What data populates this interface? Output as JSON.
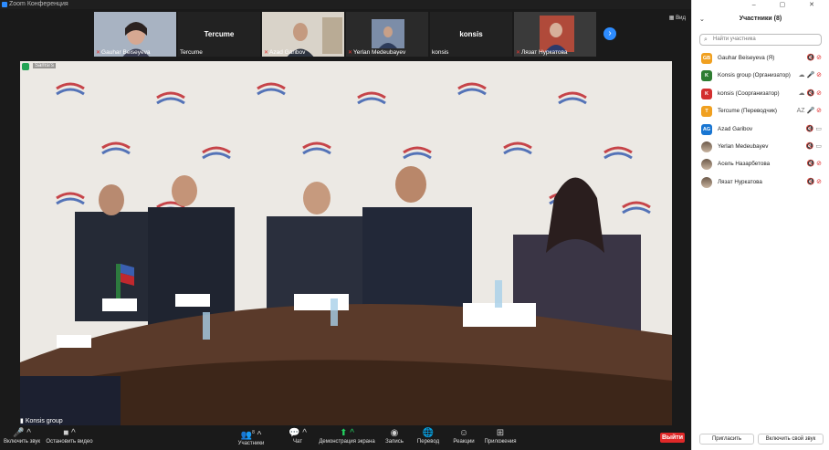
{
  "window": {
    "title": "Zoom Конференция"
  },
  "thumbnails": [
    {
      "name": "Gauhar Beiseyeva",
      "type": "video",
      "muted": true
    },
    {
      "name": "Tercume",
      "type": "name-only",
      "muted": false
    },
    {
      "name": "Azad Garibov",
      "type": "video",
      "muted": true
    },
    {
      "name": "Yerlan Medeubayev",
      "type": "video",
      "muted": true
    },
    {
      "name": "konsis",
      "type": "name-only",
      "muted": false
    },
    {
      "name": "Лязат Нуркатова",
      "type": "video",
      "muted": true
    }
  ],
  "view_button": "Вид",
  "main_video": {
    "speaker_badge": "Samsi's",
    "active_speaker": "Konsis group"
  },
  "toolbar": {
    "unmute": "Включить звук",
    "start_video": "Остановить видео",
    "participants": "Участники",
    "participants_count": "8",
    "chat": "Чат",
    "share": "Демонстрация экрана",
    "record": "Запись",
    "translate": "Перевод",
    "reactions": "Реакции",
    "apps": "Приложения",
    "leave": "Выйти"
  },
  "panel": {
    "title": "Участники (8)",
    "search_placeholder": "Найти участника",
    "participants": [
      {
        "initials": "GB",
        "color": "#f0a020",
        "name": "Gauhar Beiseyeva (Я)",
        "icons": "🔇 ⊘"
      },
      {
        "initials": "K",
        "color": "#2e7d32",
        "name": "Konsis group (Организатор)",
        "icons": "☁ 🎤 ⊘"
      },
      {
        "initials": "K",
        "color": "#d32f2f",
        "name": "konsis (Соорганизатор)",
        "icons": "☁ 🔇 ⊘"
      },
      {
        "initials": "T",
        "color": "#f0a020",
        "name": "Tercume (Переводчик)",
        "icons": "AZ 🎤 ⊘"
      },
      {
        "initials": "AG",
        "color": "#1976d2",
        "name": "Azad Garibov",
        "icons": "🔇 ▭"
      },
      {
        "initials": "",
        "color": "",
        "name": "Yerlan Medeubayev",
        "icons": "🔇 ▭"
      },
      {
        "initials": "",
        "color": "",
        "name": "Асель Назарбетова",
        "icons": "🔇 ⊘"
      },
      {
        "initials": "",
        "color": "",
        "name": "Лязат Нуркатова",
        "icons": "🔇 ⊘"
      }
    ],
    "invite_button": "Пригласить",
    "unmute_self_button": "Включить свой звук"
  }
}
